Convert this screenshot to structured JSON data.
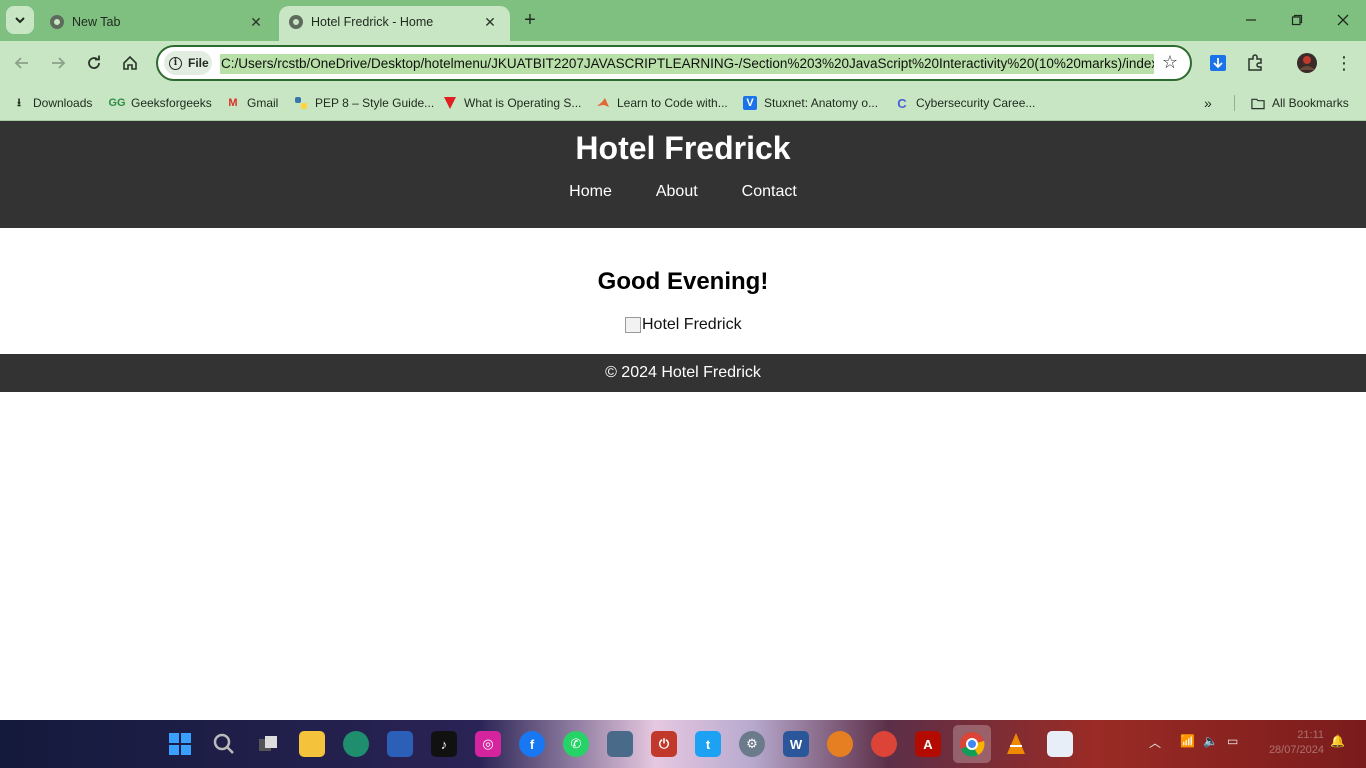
{
  "browser": {
    "tabs": [
      {
        "title": "New Tab",
        "active": false
      },
      {
        "title": "Hotel Fredrick - Home",
        "active": true
      }
    ],
    "chip_label": "File",
    "url": "C:/Users/rcstb/OneDrive/Desktop/hotelmenu/JKUATBIT2207JAVASCRIPTLEARNING-/Section%203%20JavaScript%20Interactivity%20(10%20marks)/index",
    "bookmarks": [
      "Downloads",
      "Geeksforgeeks",
      "Gmail",
      "PEP 8 – Style Guide...",
      "What is Operating S...",
      "Learn to Code with...",
      "Stuxnet: Anatomy o...",
      "Cybersecurity Caree..."
    ],
    "all_bookmarks": "All Bookmarks",
    "colors": {
      "frame": "#7fbf7f",
      "toolbar": "#c9e6c4",
      "accent": "#2d6a2d"
    }
  },
  "site": {
    "title": "Hotel Fredrick",
    "nav": [
      "Home",
      "About",
      "Contact"
    ],
    "greeting": "Good Evening!",
    "image_alt": "Hotel Fredrick",
    "footer": "© 2024 Hotel Fredrick",
    "colors": {
      "header_bg": "#333333",
      "text_on_dark": "#ffffff"
    }
  },
  "taskbar": {
    "time": "21:11",
    "date": "28/07/2024"
  }
}
